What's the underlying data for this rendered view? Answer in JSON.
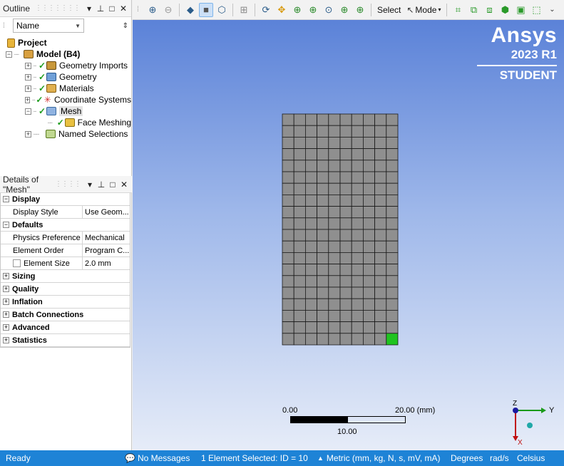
{
  "outline": {
    "title": "Outline",
    "name_filter": "Name",
    "tree": [
      {
        "label": "Project",
        "bold": true
      },
      {
        "label": "Model (B4)",
        "bold": true
      },
      {
        "label": "Geometry Imports"
      },
      {
        "label": "Geometry"
      },
      {
        "label": "Materials"
      },
      {
        "label": "Coordinate Systems"
      },
      {
        "label": "Mesh"
      },
      {
        "label": "Face Meshing"
      },
      {
        "label": "Named Selections"
      }
    ]
  },
  "details": {
    "title": "Details of \"Mesh\"",
    "groups": {
      "display": "Display",
      "defaults": "Defaults",
      "sizing": "Sizing",
      "quality": "Quality",
      "inflation": "Inflation",
      "batch": "Batch Connections",
      "advanced": "Advanced",
      "statistics": "Statistics"
    },
    "rows": {
      "display_style": {
        "key": "Display Style",
        "value": "Use Geom..."
      },
      "physics_pref": {
        "key": "Physics Preference",
        "value": "Mechanical"
      },
      "element_order": {
        "key": "Element Order",
        "value": "Program C..."
      },
      "element_size": {
        "key": "Element Size",
        "value": "2.0 mm"
      }
    }
  },
  "toolbar": {
    "select_label": "Select",
    "mode_label": "Mode"
  },
  "brand": {
    "name": "Ansys",
    "version": "2023 R1",
    "edition": "STUDENT"
  },
  "scale": {
    "start": "0.00",
    "end": "20.00",
    "unit": "(mm)",
    "mid": "10.00"
  },
  "triad": {
    "y": "Y",
    "z": "Z",
    "x": "X"
  },
  "mesh": {
    "columns": 10,
    "rows": 20,
    "selected_cell": {
      "col": 10,
      "row": 20
    }
  },
  "status": {
    "ready": "Ready",
    "messages": "No Messages",
    "selection": "1 Element Selected: ID = 10",
    "units": "Metric (mm, kg, N, s, mV, mA)",
    "angle": "Degrees",
    "rot": "rad/s",
    "temp": "Celsius"
  },
  "colors": {
    "status_bar": "#1e83d6",
    "mesh_fill": "#8f8f8f",
    "selected_element": "#1fc41f",
    "viewport_top": "#5b82d8",
    "viewport_bottom": "#e6ecf8"
  }
}
